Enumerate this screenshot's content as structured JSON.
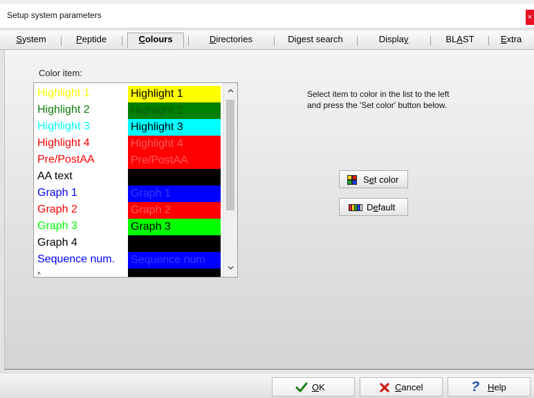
{
  "window": {
    "title": "Setup system parameters",
    "close_glyph": "×"
  },
  "tabs": [
    {
      "label_pre": "",
      "label_u": "S",
      "label_post": "ystem",
      "active": false
    },
    {
      "label_pre": "",
      "label_u": "P",
      "label_post": "eptide",
      "active": false
    },
    {
      "label_pre": "",
      "label_u": "C",
      "label_post": "olours",
      "active": true
    },
    {
      "label_pre": "",
      "label_u": "D",
      "label_post": "irectories",
      "active": false
    },
    {
      "label_pre": "Di",
      "label_u": "g",
      "label_post": "est search",
      "active": false
    },
    {
      "label_pre": "Displa",
      "label_u": "y",
      "label_post": "",
      "active": false
    },
    {
      "label_pre": "BL",
      "label_u": "A",
      "label_post": "ST",
      "active": false
    },
    {
      "label_pre": "",
      "label_u": "E",
      "label_post": "xtra",
      "active": false
    }
  ],
  "colours": {
    "list_label": "Color item:",
    "items": [
      {
        "name": "Highlight 1",
        "name_color": "#ffff00",
        "swatch_text": "Highlight 1",
        "bg": "#ffff00",
        "fg": "#000000"
      },
      {
        "name": "Highlight 2",
        "name_color": "#0a7a0a",
        "swatch_text": "Highlight 2",
        "bg": "#008000",
        "fg": "#0b5a0b"
      },
      {
        "name": "Highlight 3",
        "name_color": "#00ffff",
        "swatch_text": "Highlight 3",
        "bg": "#00ffff",
        "fg": "#000000"
      },
      {
        "name": "Highlight 4",
        "name_color": "#ff0000",
        "swatch_text": "Highlight 4",
        "bg": "#ff0000",
        "fg": "#ff5b5b"
      },
      {
        "name": "Pre/PostAA",
        "name_color": "#ff0000",
        "swatch_text": "Pre/PostAA",
        "bg": "#ff0000",
        "fg": "#ff5b5b"
      },
      {
        "name": "AA text",
        "name_color": "#000000",
        "swatch_text": "",
        "bg": "#000000",
        "fg": "#000000"
      },
      {
        "name": "Graph 1",
        "name_color": "#0000ff",
        "swatch_text": "Graph 1",
        "bg": "#0000ff",
        "fg": "#3a3aff"
      },
      {
        "name": "Graph 2",
        "name_color": "#ff0000",
        "swatch_text": "Graph 2",
        "bg": "#ff0000",
        "fg": "#ff5b5b"
      },
      {
        "name": "Graph 3",
        "name_color": "#00ff00",
        "swatch_text": "Graph 3",
        "bg": "#00ff00",
        "fg": "#000000"
      },
      {
        "name": "Graph 4",
        "name_color": "#000000",
        "swatch_text": "",
        "bg": "#000000",
        "fg": "#000000"
      },
      {
        "name": "Sequence num.",
        "name_color": "#0000ff",
        "swatch_text": "Sequence num",
        "bg": "#0000ff",
        "fg": "#3a3aff"
      }
    ],
    "help_text": "Select item to color in the list to the left and press the 'Set color' button below.",
    "set_color_pre": "S",
    "set_color_u": "e",
    "set_color_post": "t color",
    "default_pre": "D",
    "default_u": "e",
    "default_post": "fault"
  },
  "footer": {
    "ok_u": "O",
    "ok_post": "K",
    "cancel_u": "C",
    "cancel_post": "ancel",
    "help_u": "H",
    "help_post": "elp"
  },
  "icons": [
    "close-icon",
    "set-color-icon",
    "default-icon",
    "checkmark-icon",
    "x-icon",
    "help-icon",
    "scroll-up-icon",
    "scroll-down-icon"
  ]
}
